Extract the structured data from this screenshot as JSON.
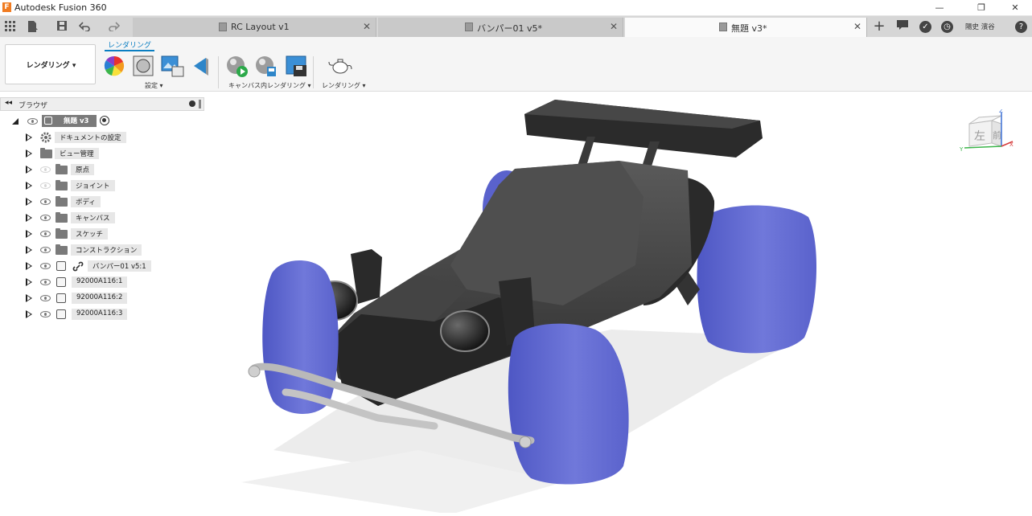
{
  "app": {
    "title": "Autodesk Fusion 360",
    "logo_letter": "F"
  },
  "window_controls": {
    "minimize": "—",
    "restore": "❐",
    "close": "✕"
  },
  "tabs": [
    {
      "label": "RC Layout v1",
      "active": false
    },
    {
      "label": "バンパー01 v5*",
      "active": false
    },
    {
      "label": "無題 v3*",
      "active": true
    }
  ],
  "user": {
    "name": "陽史 濱谷"
  },
  "ribbon": {
    "workspace": "レンダリング",
    "active_tab": "レンダリング",
    "groups": [
      {
        "label": "設定"
      },
      {
        "label": "キャンバス内レンダリング"
      },
      {
        "label": "レンダリング"
      }
    ]
  },
  "browser": {
    "title": "ブラウザ",
    "root": {
      "label": "無題 v3"
    },
    "items": [
      {
        "label": "ドキュメントの設定",
        "icon": "gear-icon"
      },
      {
        "label": "ビュー管理",
        "icon": "folder-icon"
      },
      {
        "label": "原点",
        "icon": "folder-icon"
      },
      {
        "label": "ジョイント",
        "icon": "folder-icon"
      },
      {
        "label": "ボディ",
        "icon": "folder-icon"
      },
      {
        "label": "キャンバス",
        "icon": "folder-icon"
      },
      {
        "label": "スケッチ",
        "icon": "folder-icon"
      },
      {
        "label": "コンストラクション",
        "icon": "folder-icon"
      },
      {
        "label": "バンパー01 v5:1",
        "icon": "link-icon"
      },
      {
        "label": "92000A116:1",
        "icon": "component-icon"
      },
      {
        "label": "92000A116:2",
        "icon": "component-icon"
      },
      {
        "label": "92000A116:3",
        "icon": "component-icon"
      }
    ]
  },
  "viewcube": {
    "face_left": "左",
    "face_front": "前",
    "axis_z": "Z",
    "axis_x": "X",
    "axis_y": "Y"
  },
  "colors": {
    "accent": "#0a7ec2",
    "wheel": "#6a72d6",
    "body": "#3a3a3a",
    "bumper": "#c8c8c8"
  }
}
